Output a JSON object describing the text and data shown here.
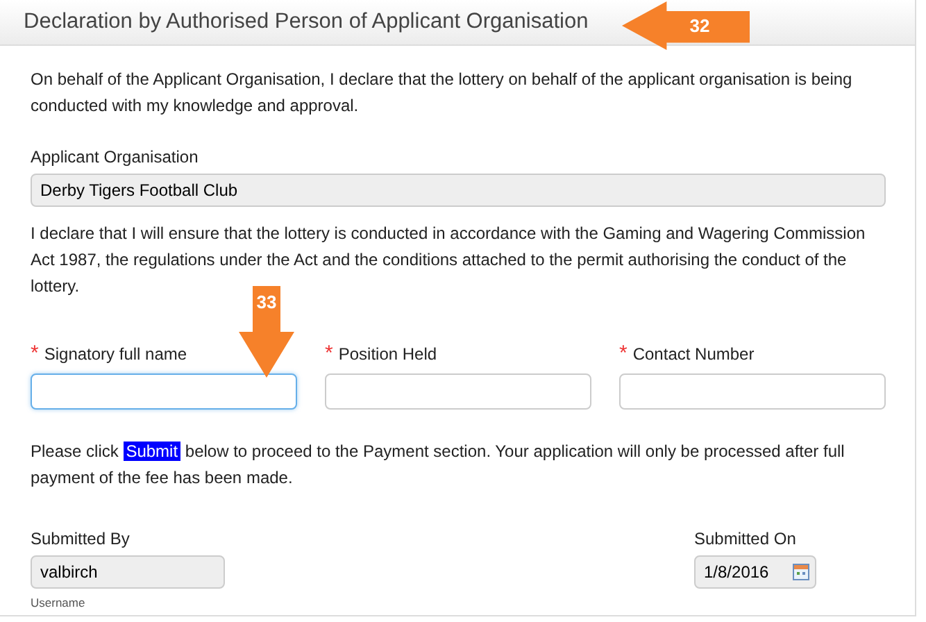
{
  "header": {
    "title": "Declaration by Authorised Person of Applicant Organisation"
  },
  "intro": "On behalf of the Applicant Organisation, I declare that the lottery on behalf of the applicant organisation is being conducted with my knowledge and approval.",
  "organisation": {
    "label": "Applicant Organisation",
    "value": "Derby Tigers Football Club"
  },
  "declaration": "I declare that I will ensure that the lottery is conducted in accordance with the Gaming and Wagering Commission Act 1987, the regulations under the Act and the conditions attached to the permit authorising the conduct of the lottery.",
  "fields": [
    {
      "required_mark": "*",
      "label": "Signatory full name",
      "focused": true
    },
    {
      "required_mark": "*",
      "label": "Position Held",
      "focused": false
    },
    {
      "required_mark": "*",
      "label": "Contact Number",
      "focused": false
    }
  ],
  "notice": {
    "before": "Please click",
    "highlight": "Submit",
    "after": "below to proceed to the Payment section. Your application will only be processed after full payment of the fee has been made."
  },
  "submitted_by": {
    "label": "Submitted By",
    "value": "valbirch",
    "hint": "Username"
  },
  "submitted_on": {
    "label": "Submitted On",
    "value": "1/8/2016"
  },
  "annotations": [
    {
      "number": "32",
      "kind": "left"
    },
    {
      "number": "33",
      "kind": "down"
    }
  ]
}
